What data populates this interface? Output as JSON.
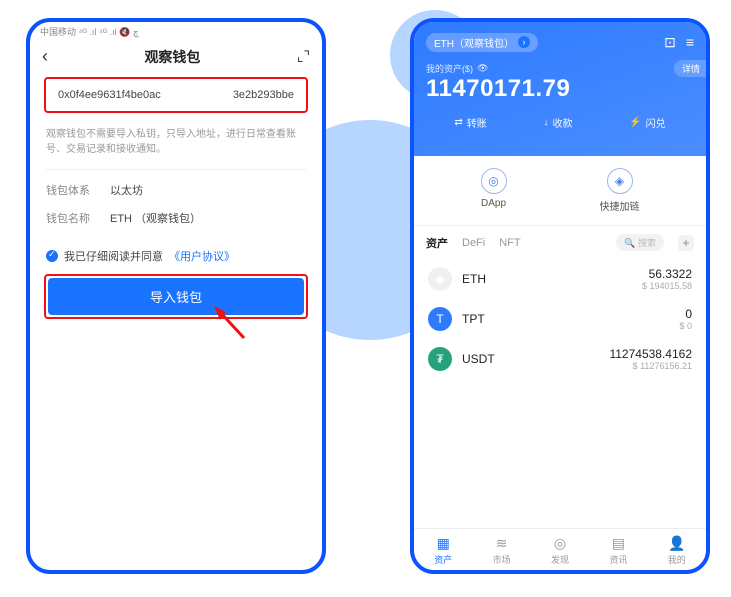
{
  "left": {
    "status": "中国移动 ⁴ᴳ .ıl ⁴ᴳ .ıl 🔇 چ",
    "title": "观察钱包",
    "addr_left": "0x0f4ee9631f4be0ac",
    "addr_right": "3e2b293bbe",
    "hint": "观察钱包不需要导入私钥，只导入地址，进行日常查看账号、交易记录和接收通知。",
    "system_label": "钱包体系",
    "system_value": "以太坊",
    "name_label": "钱包名称",
    "name_value": "ETH （观察钱包）",
    "agree_text": "我已仔细阅读并同意",
    "agree_link": "《用户协议》",
    "import_btn": "导入钱包"
  },
  "right": {
    "pill": "ETH（观察钱包）",
    "balance_label": "我的资产($)",
    "detail": "详情",
    "balance": "11470171.79",
    "act_transfer": "转账",
    "act_receive": "收款",
    "act_swap": "闪兑",
    "shortcut_dapp": "DApp",
    "shortcut_fast": "快捷加链",
    "tab_asset": "资产",
    "tab_defi": "DeFi",
    "tab_nft": "NFT",
    "search_ph": "搜索",
    "assets": [
      {
        "sym": "ETH",
        "amount": "56.3322",
        "fiat": "$ 194015.58"
      },
      {
        "sym": "TPT",
        "amount": "0",
        "fiat": "$ 0"
      },
      {
        "sym": "USDT",
        "amount": "11274538.4162",
        "fiat": "$ 11276156.21"
      }
    ],
    "nav": {
      "asset": "资产",
      "market": "市场",
      "discover": "发现",
      "news": "资讯",
      "me": "我的"
    }
  }
}
